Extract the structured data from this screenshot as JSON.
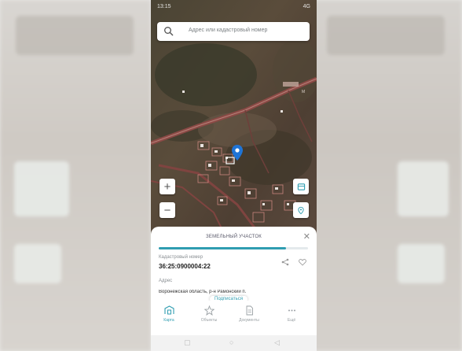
{
  "status_bar": {
    "time": "13:15",
    "signal": "4G"
  },
  "search": {
    "placeholder": "Адрес или кадастровый номер"
  },
  "map": {
    "label": "М"
  },
  "sheet": {
    "title": "ЗЕМЕЛЬНЫЙ УЧАСТОК",
    "progress": 0.85,
    "cadastral_label": "Кадастровый номер",
    "cadastral_value": "36:25:0900004:22",
    "address_label": "Адрес",
    "address_value": "Воронежская область, р-н Рамонский п.",
    "subscribe_label": "Подписаться"
  },
  "tabs": [
    {
      "label": "Карта",
      "icon": "map-icon",
      "active": true
    },
    {
      "label": "Объекты",
      "icon": "star-icon",
      "active": false
    },
    {
      "label": "Документы",
      "icon": "document-icon",
      "active": false
    },
    {
      "label": "Ещё",
      "icon": "more-icon",
      "active": false
    }
  ],
  "colors": {
    "accent": "#2f9db1",
    "pin": "#1f74d6"
  }
}
